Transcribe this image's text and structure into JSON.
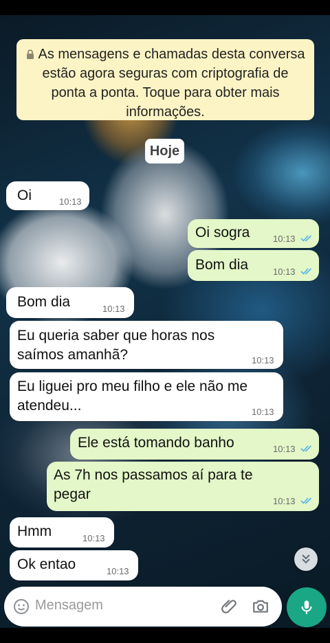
{
  "notice": {
    "text": "As mensagens e chamadas desta conversa estão agora seguras com criptografia de ponta a ponta. Toque para obter mais informações."
  },
  "date_chip": "Hoje",
  "messages": [
    {
      "direction": "in",
      "text": "Oi",
      "time": "10:13"
    },
    {
      "direction": "out",
      "text": "Oi sogra",
      "time": "10:13",
      "read": true
    },
    {
      "direction": "out",
      "text": "Bom dia",
      "time": "10:13",
      "read": true
    },
    {
      "direction": "in",
      "text": "Bom dia",
      "time": "10:13"
    },
    {
      "direction": "in",
      "text_lines": [
        "Eu queria saber que horas nos",
        "saímos amanhã?"
      ],
      "time": "10:13"
    },
    {
      "direction": "in",
      "text_lines": [
        "Eu liguei pro meu filho e ele não me",
        "atendeu..."
      ],
      "time": "10:13"
    },
    {
      "direction": "out",
      "text": "Ele está tomando banho",
      "time": "10:13",
      "read": true
    },
    {
      "direction": "out",
      "text_lines": [
        "As 7h nos passamos aí para te",
        "pegar"
      ],
      "time": "10:13",
      "read": true
    },
    {
      "direction": "in",
      "text": "Hmm",
      "time": "10:13"
    },
    {
      "direction": "in",
      "text": "Ok entao",
      "time": "10:13"
    }
  ],
  "composer": {
    "placeholder": "Mensagem",
    "icons": [
      "emoji-icon",
      "attach-icon",
      "camera-icon",
      "mic-icon"
    ]
  },
  "colors": {
    "incoming_bubble": "#ffffff",
    "outgoing_bubble": "#e3f7c8",
    "notice_bg": "#fdf4c5",
    "read_ticks": "#4fb6ec",
    "mic_button": "#1aa785"
  }
}
